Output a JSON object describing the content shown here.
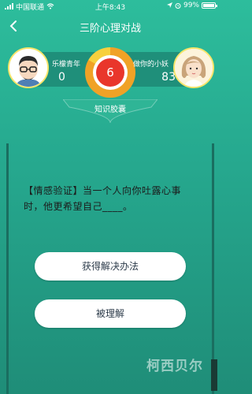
{
  "status": {
    "carrier": "中国联通",
    "time": "上午8:43",
    "battery": "99%"
  },
  "nav": {
    "title": "三阶心理对战"
  },
  "players": {
    "left": {
      "name": "乐檬青年",
      "score": "0"
    },
    "right": {
      "name": "做你的小妖",
      "score": "83"
    }
  },
  "timer": {
    "value": "6"
  },
  "category": {
    "label": "知识胶囊"
  },
  "question": {
    "text": "【情感验证】当一个人向你吐露心事时，他更希望自己____。"
  },
  "answers": [
    {
      "label": "获得解决办法"
    },
    {
      "label": "被理解"
    }
  ],
  "watermark": "柯西贝尔",
  "colors": {
    "background": "#2dbd9c",
    "timer_red": "#e9362b",
    "timer_ring": "#f0a226",
    "avatar_border": "#f7e56a"
  }
}
